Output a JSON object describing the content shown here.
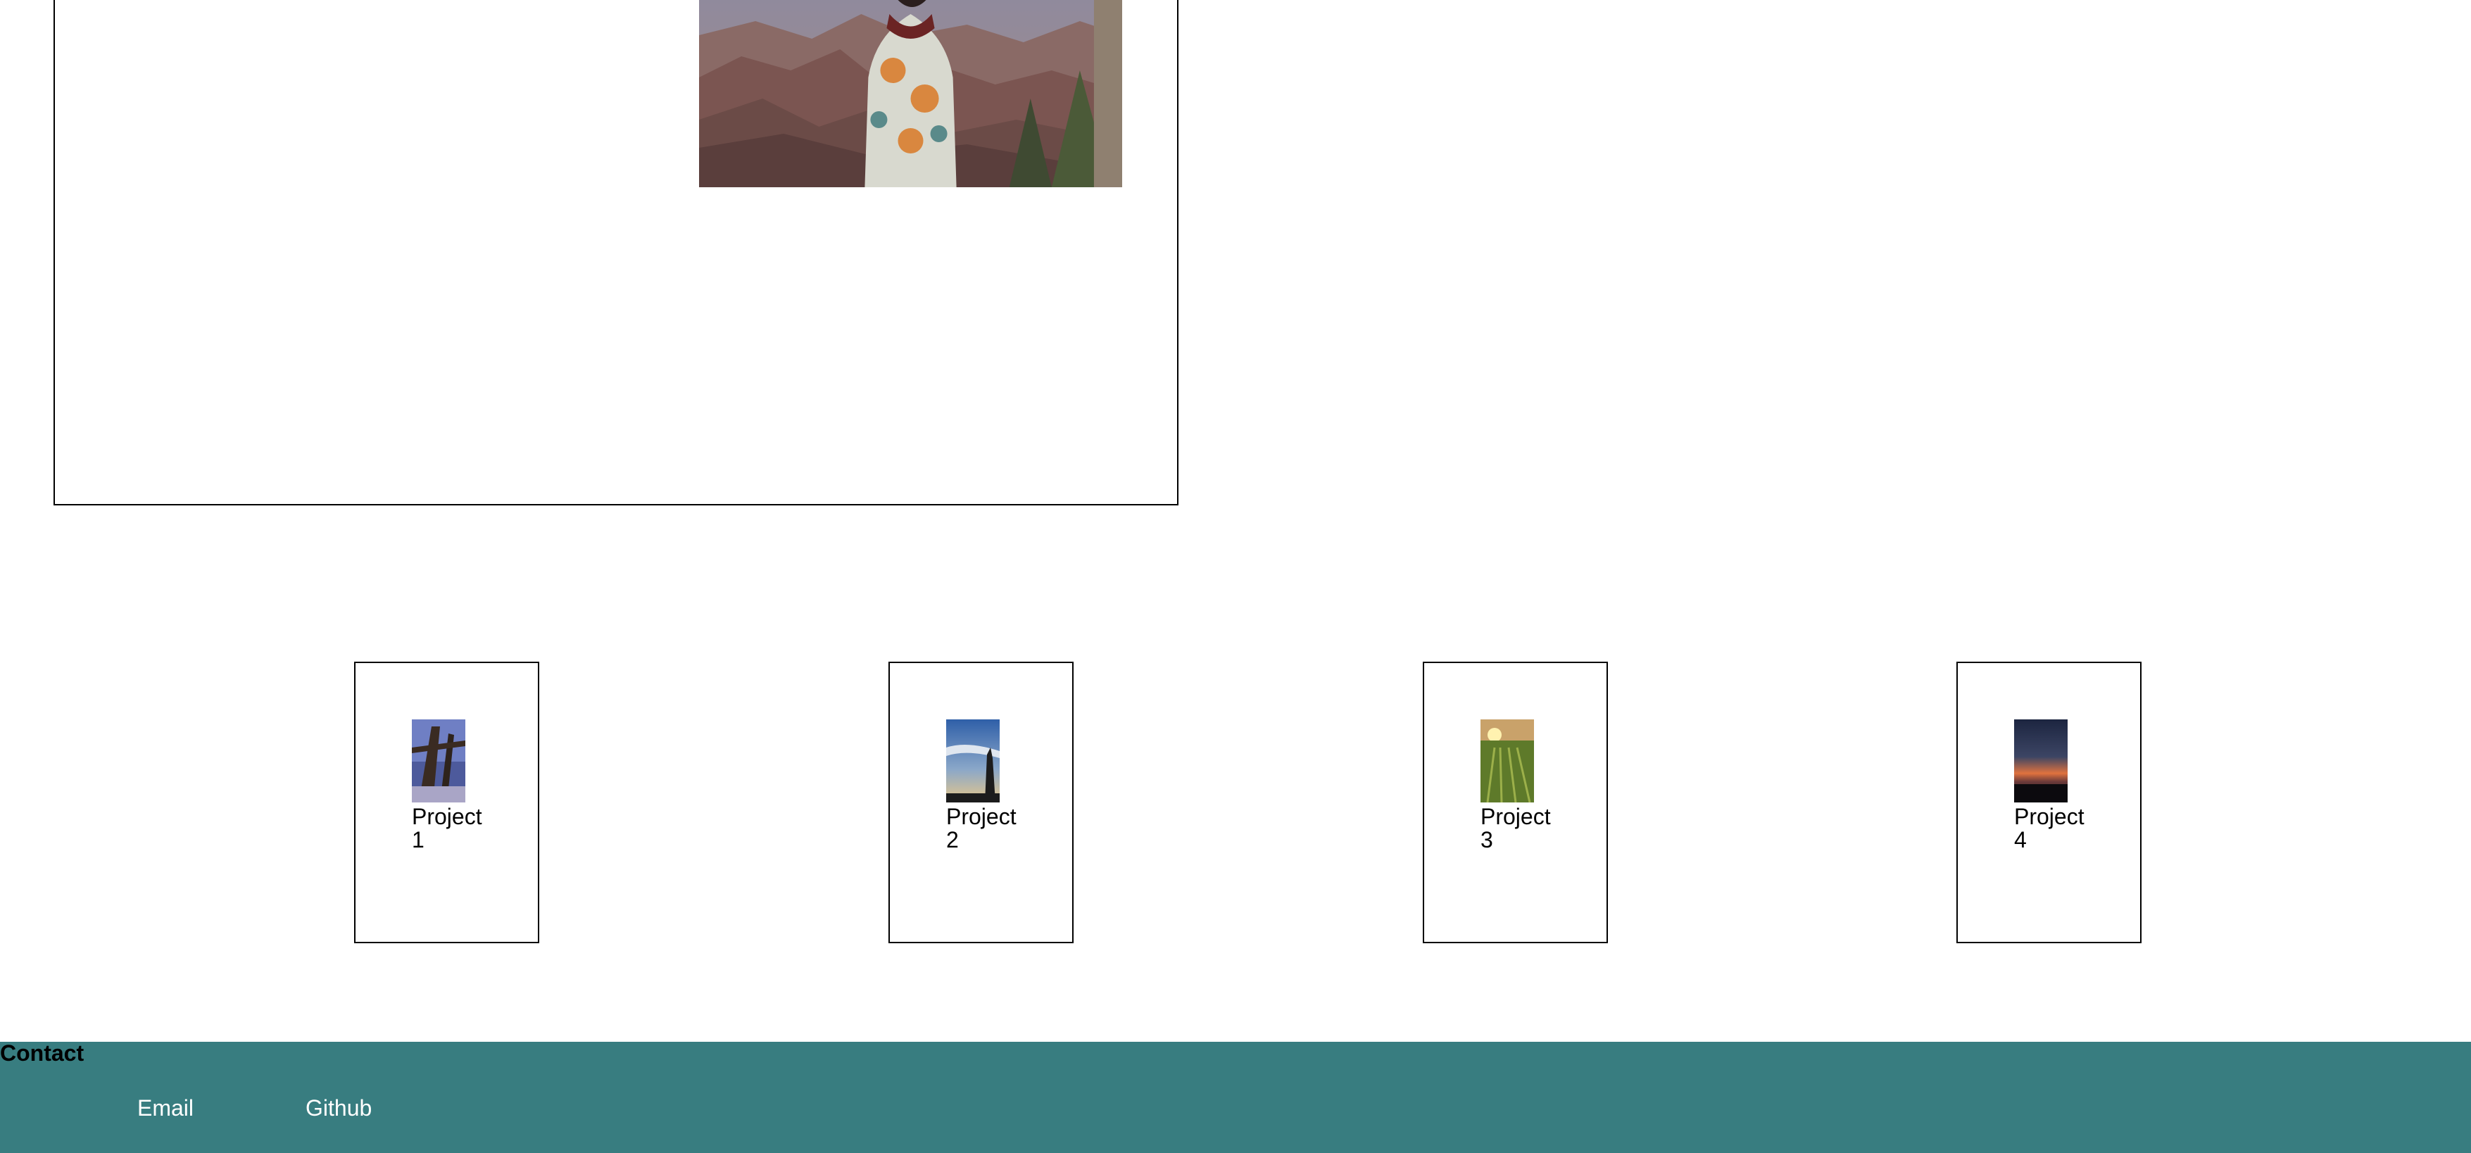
{
  "projects": [
    {
      "label": "Project 1"
    },
    {
      "label": "Project 2"
    },
    {
      "label": "Project 3"
    },
    {
      "label": "Project 4"
    }
  ],
  "footer": {
    "heading": "Contact",
    "links": [
      {
        "label": "Email"
      },
      {
        "label": "Github"
      }
    ],
    "background_color": "#387d80"
  }
}
